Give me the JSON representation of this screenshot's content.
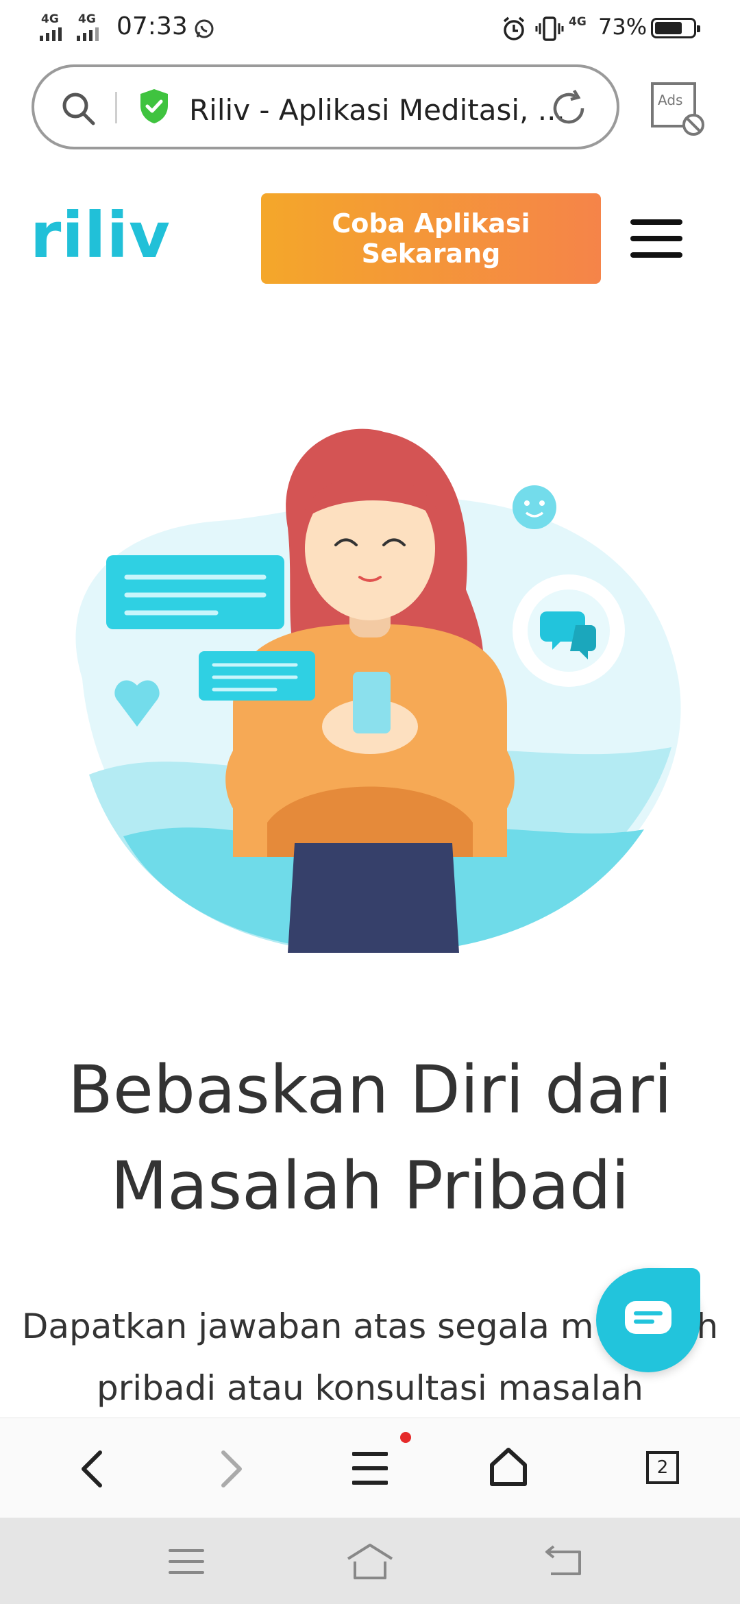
{
  "status_bar": {
    "network_1": "4G",
    "network_2": "4G",
    "time": "07:33",
    "network_3": "4G",
    "battery_percent": "73%",
    "battery_level": 0.73,
    "icons": [
      "whatsapp-icon",
      "alarm-icon",
      "vibrate-icon",
      "battery-icon"
    ]
  },
  "browser": {
    "url_title": "Riliv - Aplikasi Meditasi, ...",
    "ads_label": "Ads",
    "tab_count": "2",
    "icons": [
      "search-icon",
      "secure-shield-icon",
      "reload-icon",
      "ads-block-icon",
      "back-icon",
      "forward-icon",
      "menu-icon",
      "home-icon",
      "tabs-icon"
    ]
  },
  "site": {
    "logo": "riliv",
    "cta_label": "Coba Aplikasi Sekarang",
    "headline_line1": "Bebaskan Diri dari",
    "headline_line2": "Masalah Pribadi",
    "subtext_line1": "Dapatkan jawaban atas segala m",
    "subtext_line1_tail": "h",
    "subtext_line2": "pribadi atau konsultasi masalah"
  },
  "colors": {
    "brand": "#21c0d8",
    "cta_start": "#f4a72a",
    "cta_end": "#f58449",
    "text": "#333333"
  }
}
